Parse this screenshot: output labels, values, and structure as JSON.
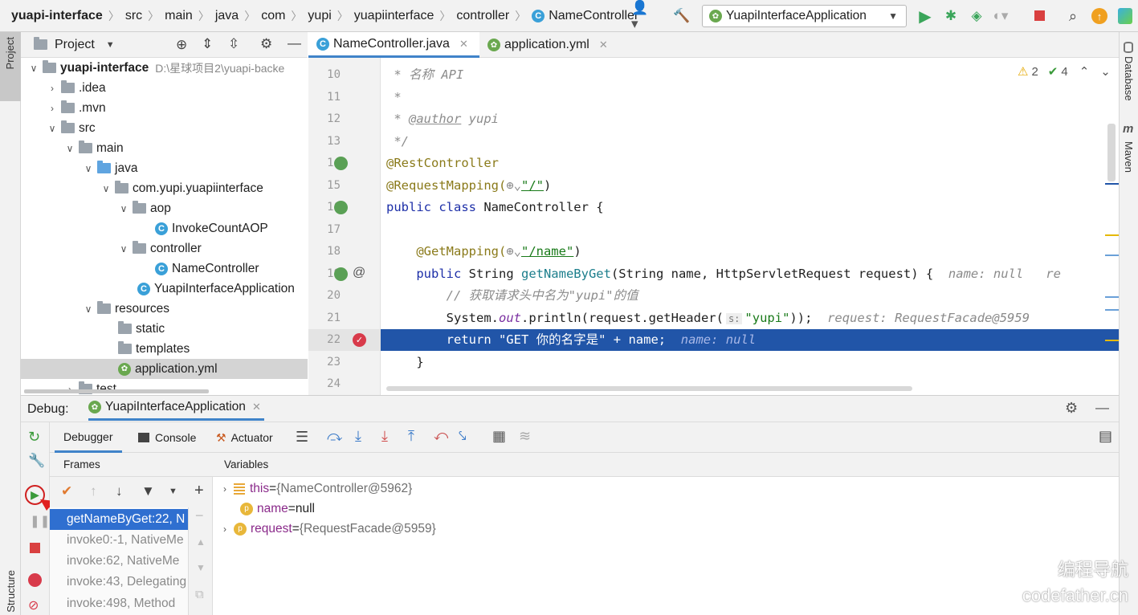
{
  "breadcrumb": [
    "yuapi-interface",
    "src",
    "main",
    "java",
    "com",
    "yupi",
    "yuapiinterface",
    "controller",
    "NameController"
  ],
  "run_config": "YuapiInterfaceApplication",
  "left_strip": {
    "project": "Project",
    "structure": "Structure"
  },
  "right_strip": {
    "database": "Database",
    "maven": "Maven"
  },
  "project_panel": {
    "title": "Project"
  },
  "tree": [
    {
      "label": "yuapi-interface",
      "path": "D:\\星球项目2\\yuapi-backe"
    },
    {
      "label": ".idea"
    },
    {
      "label": ".mvn"
    },
    {
      "label": "src"
    },
    {
      "label": "main"
    },
    {
      "label": "java"
    },
    {
      "label": "com.yupi.yuapiinterface"
    },
    {
      "label": "aop"
    },
    {
      "label": "InvokeCountAOP"
    },
    {
      "label": "controller"
    },
    {
      "label": "NameController"
    },
    {
      "label": "YuapiInterfaceApplication"
    },
    {
      "label": "resources"
    },
    {
      "label": "static"
    },
    {
      "label": "templates"
    },
    {
      "label": "application.yml"
    },
    {
      "label": "test"
    }
  ],
  "editor_tabs": [
    "NameController.java",
    "application.yml"
  ],
  "inspections": {
    "warnings": "2",
    "checks": "4"
  },
  "line_numbers": [
    "10",
    "11",
    "12",
    "13",
    "14",
    "15",
    "16",
    "17",
    "18",
    "19",
    "20",
    "21",
    "22",
    "23",
    "24"
  ],
  "code": {
    "l10": " * 名称 API",
    "l11": " *",
    "l12a": " * ",
    "l12b": "@author",
    "l12c": " yupi",
    "l13": " */",
    "l14": "@RestController",
    "l15a": "@RequestMapping(",
    "l15b": "\"/\"",
    "l15c": ")",
    "l16a": "public class ",
    "l16b": "NameController {",
    "l18a": "    @GetMapping(",
    "l18b": "\"/name\"",
    "l18c": ")",
    "l19a": "    public ",
    "l19b": "String ",
    "l19c": "getNameByGet",
    "l19d": "(String name, HttpServletRequest request) {",
    "l19hint": "name: null",
    "l19trail": "re",
    "l20": "        // 获取请求头中名为\"yupi\"的值",
    "l21a": "        System.",
    "l21b": "out",
    "l21c": ".println(request.getHeader(",
    "l21d": "s:",
    "l21e": "\"yupi\"",
    "l21f": "));",
    "l21hint": "request: RequestFacade@5959",
    "l22a": "        return \"GET 你的名字是\" + name;",
    "l22hint": "name: null",
    "l23": "    }"
  },
  "debug": {
    "label": "Debug:",
    "session": "YuapiInterfaceApplication",
    "tabs": [
      "Debugger",
      "Console",
      "Actuator"
    ],
    "frames_title": "Frames",
    "variables_title": "Variables",
    "frames": [
      "getNameByGet:22, N",
      "invoke0:-1, NativeMe",
      "invoke:62, NativeMe",
      "invoke:43, Delegating",
      "invoke:498, Method"
    ],
    "variables": [
      {
        "name": "this",
        "eq": " = ",
        "value": "{NameController@5962}"
      },
      {
        "name": "name",
        "eq": " = ",
        "value": "null"
      },
      {
        "name": "request",
        "eq": " = ",
        "value": "{RequestFacade@5959}"
      }
    ]
  },
  "watermark": [
    "编程导航",
    "codefather.cn"
  ]
}
